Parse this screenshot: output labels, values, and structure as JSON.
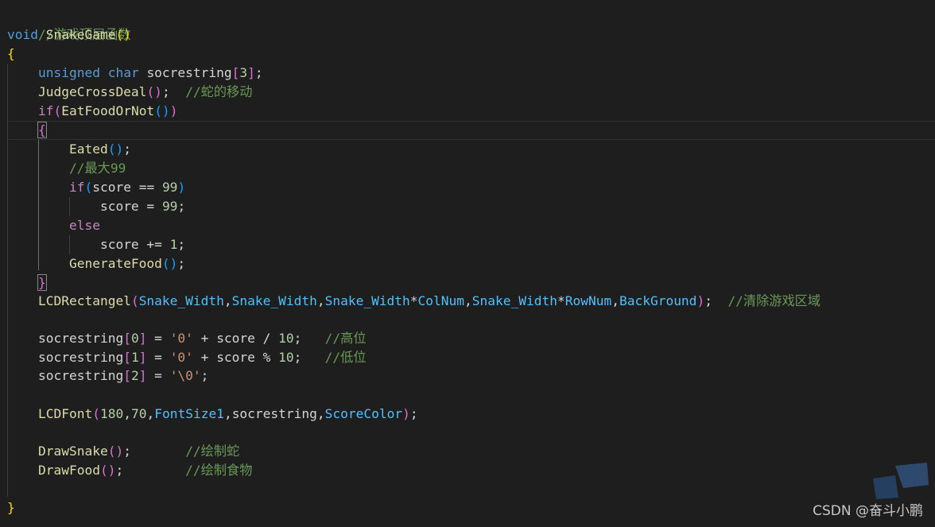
{
  "code": {
    "l1": {
      "comment": "//游戏顶层函数"
    },
    "l2": {
      "kw": "void",
      "fn": "SnakeGame",
      "open": "(",
      "close": ")"
    },
    "l3": {
      "brace": "{"
    },
    "l4": {
      "kw1": "unsigned",
      "kw2": "char",
      "var": "socrestring",
      "ob": "[",
      "num": "3",
      "cb": "]",
      "semi": ";"
    },
    "l5": {
      "fn": "JudgeCrossDeal",
      "parens": "()",
      "semi": ";",
      "comment": "//蛇的移动"
    },
    "l6": {
      "kw": "if",
      "open": "(",
      "fn": "EatFoodOrNot",
      "inner": "()",
      "close": ")"
    },
    "l7": {
      "brace": "{"
    },
    "l8": {
      "fn": "Eated",
      "parens": "()",
      "semi": ";"
    },
    "l9": {
      "comment": "//最大99"
    },
    "l10": {
      "kw": "if",
      "open": "(",
      "var": "score",
      "op": " == ",
      "num": "99",
      "close": ")"
    },
    "l11": {
      "var": "score",
      "op": " = ",
      "num": "99",
      "semi": ";"
    },
    "l12": {
      "kw": "else"
    },
    "l13": {
      "var": "score",
      "op": " += ",
      "num": "1",
      "semi": ";"
    },
    "l14": {
      "fn": "GenerateFood",
      "parens": "()",
      "semi": ";"
    },
    "l15": {
      "brace": "}"
    },
    "l16": {
      "fn": "LCDRectangel",
      "open": "(",
      "a1": "Snake_Width",
      "c1": ",",
      "a2": "Snake_Width",
      "c2": ",",
      "a3": "Snake_Width",
      "op3": "*",
      "a3b": "ColNum",
      "c3": ",",
      "a4": "Snake_Width",
      "op4": "*",
      "a4b": "RowNum",
      "c4": ",",
      "a5": "BackGround",
      "close": ")",
      "semi": ";",
      "comment": "//清除游戏区域"
    },
    "l18": {
      "var": "socrestring",
      "ob": "[",
      "idx": "0",
      "cb": "]",
      "op1": " = ",
      "str": "'0'",
      "op2": " + ",
      "var2": "score",
      "op3": " / ",
      "num": "10",
      "semi": ";",
      "comment": "//高位"
    },
    "l19": {
      "var": "socrestring",
      "ob": "[",
      "idx": "1",
      "cb": "]",
      "op1": " = ",
      "str": "'0'",
      "op2": " + ",
      "var2": "score",
      "op3": " % ",
      "num": "10",
      "semi": ";",
      "comment": "//低位"
    },
    "l20": {
      "var": "socrestring",
      "ob": "[",
      "idx": "2",
      "cb": "]",
      "op1": " = ",
      "str": "'\\0'",
      "semi": ";"
    },
    "l22": {
      "fn": "LCDFont",
      "open": "(",
      "n1": "180",
      "c1": ",",
      "n2": "70",
      "c2": ",",
      "a3": "FontSize1",
      "c3": ",",
      "a4": "socrestring",
      "c4": ",",
      "a5": "ScoreColor",
      "close": ")",
      "semi": ";"
    },
    "l24": {
      "fn": "DrawSnake",
      "parens": "()",
      "semi": ";",
      "comment": "//绘制蛇"
    },
    "l25": {
      "fn": "DrawFood",
      "parens": "()",
      "semi": ";",
      "comment": "//绘制食物"
    },
    "l27": {
      "brace": "}"
    }
  },
  "watermark": {
    "text": "CSDN @奋斗小鹏"
  },
  "colors": {
    "background": "#1e1e1e",
    "keyword": "#569cd6",
    "control": "#c586c0",
    "function": "#dcdcaa",
    "variable": "#d4d4d4",
    "constant": "#4fc1ff",
    "number": "#b5cea8",
    "string": "#ce9178",
    "comment": "#6a9955",
    "bracket1": "#ffd700",
    "bracket2": "#da70d6",
    "bracket3": "#179fff"
  }
}
